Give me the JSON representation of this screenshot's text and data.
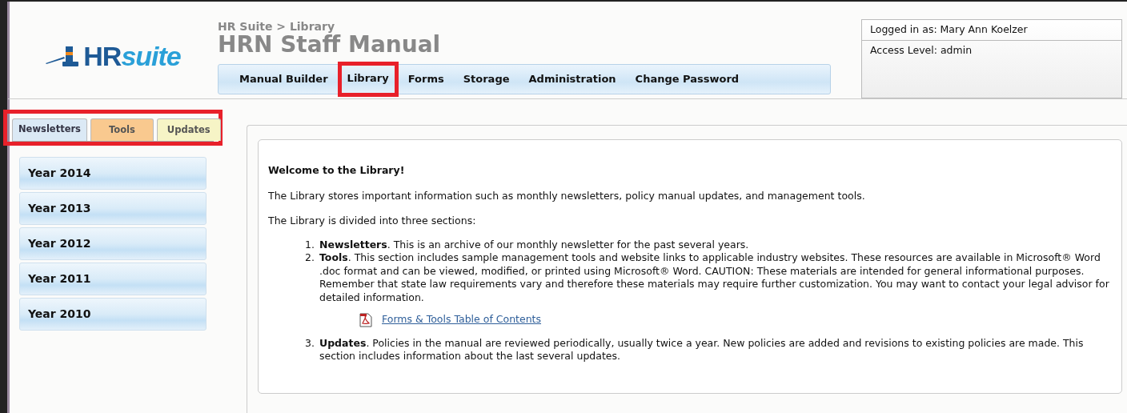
{
  "logo": {
    "brand": "HR",
    "suffix": "suite"
  },
  "header": {
    "breadcrumb": "HR Suite > Library",
    "title": "HRN Staff Manual"
  },
  "nav": [
    {
      "label": "Manual Builder",
      "highlighted": false
    },
    {
      "label": "Library",
      "highlighted": true
    },
    {
      "label": "Forms",
      "highlighted": false
    },
    {
      "label": "Storage",
      "highlighted": false
    },
    {
      "label": "Administration",
      "highlighted": false
    },
    {
      "label": "Change Password",
      "highlighted": false
    }
  ],
  "user_box": {
    "logged_in": "Logged in as: Mary Ann Koelzer",
    "access": "Access Level: admin"
  },
  "sidebar_tabs": {
    "highlighted": true,
    "items": [
      {
        "label": "Newsletters",
        "selected": true,
        "color": "#dbe9f5"
      },
      {
        "label": "Tools",
        "selected": false,
        "color": "#f9c98f"
      },
      {
        "label": "Updates",
        "selected": false,
        "color": "#f6f4c6"
      }
    ]
  },
  "sidebar": {
    "items": [
      {
        "label": "Year 2014"
      },
      {
        "label": "Year 2013"
      },
      {
        "label": "Year 2012"
      },
      {
        "label": "Year 2011"
      },
      {
        "label": "Year 2010"
      }
    ]
  },
  "content": {
    "heading": "Welcome to the Library!",
    "paragraphs": [
      "The Library stores important information such as monthly newsletters, policy manual updates, and management tools.",
      "The Library is divided into three sections:"
    ],
    "sections": [
      {
        "number": "1.",
        "text": "**Newsletters**. This is an archive of our monthly newsletter for the past several years."
      },
      {
        "number": "2.",
        "text": "**Tools**. This section includes sample management tools and website links to applicable industry websites. These resources are available in Microsoft® Word .doc format and can be viewed, modified, or printed using Microsoft® Word. CAUTION: These materials are intended for general informational purposes. Remember that state law requirements vary and therefore these materials may require further customization. You may want to contact your legal advisor for detailed information.",
        "link": "Forms & Tools Table of Contents"
      },
      {
        "number": "3.",
        "text": "**Updates**. Policies in the manual are reviewed periodically, usually twice a year. New policies are added and revisions to existing policies are made. This section includes information about the last several updates."
      }
    ]
  }
}
